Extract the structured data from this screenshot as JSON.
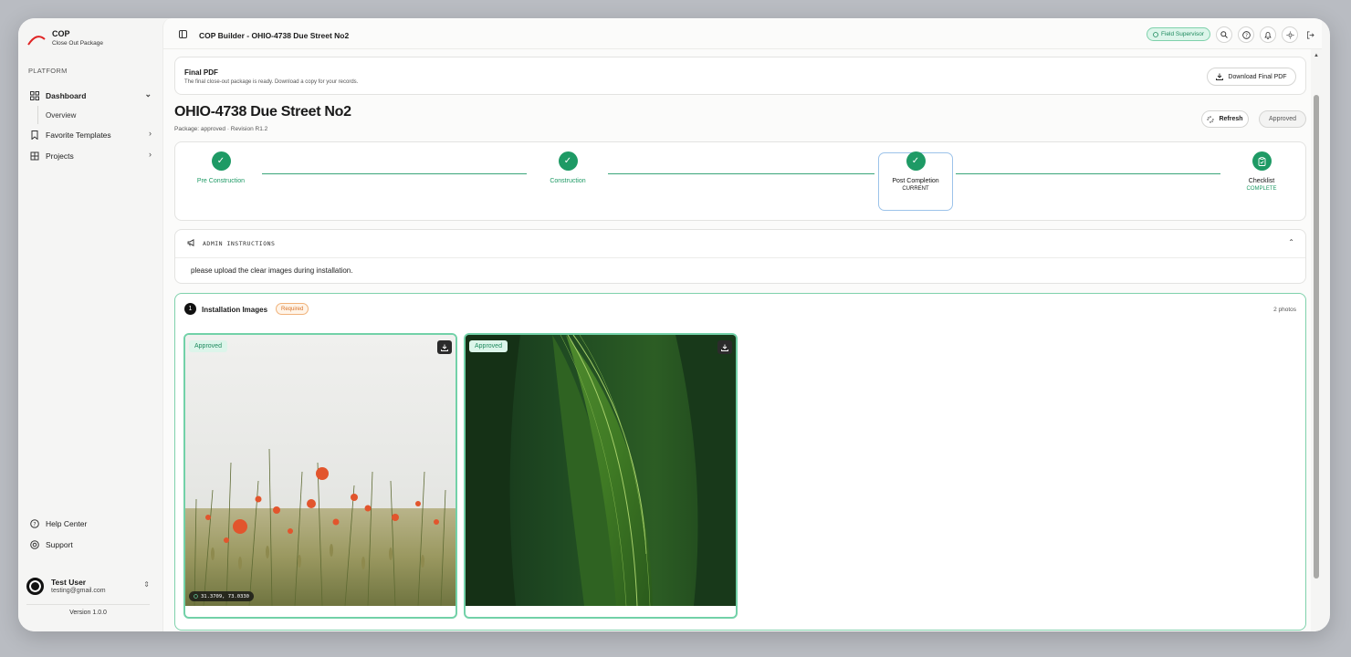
{
  "brand": {
    "title": "COP",
    "subtitle": "Close Out Package"
  },
  "sidebar": {
    "section_label": "PLATFORM",
    "items": [
      {
        "label": "Dashboard",
        "icon": "dashboard-icon"
      },
      {
        "label": "Overview"
      },
      {
        "label": "Favorite Templates",
        "icon": "bookmark-icon"
      },
      {
        "label": "Projects",
        "icon": "building-icon"
      }
    ],
    "bottom_items": [
      {
        "label": "Help Center",
        "icon": "help-icon"
      },
      {
        "label": "Support",
        "icon": "support-icon"
      }
    ],
    "user": {
      "name": "Test User",
      "email": "testing@gmail.com"
    },
    "version": "Version 1.0.0"
  },
  "topbar": {
    "title": "COP Builder - OHIO-4738 Due Street No2",
    "role": "Field Supervisor"
  },
  "final_pdf": {
    "title": "Final PDF",
    "subtitle": "The final close-out package is ready. Download a copy for your records.",
    "button": "Download Final PDF"
  },
  "package": {
    "title": "OHIO-4738 Due Street No2",
    "subtitle": "Package: approved · Revision R1.2",
    "refresh_label": "Refresh",
    "status": "Approved"
  },
  "steps": [
    {
      "label": "Pre Construction",
      "status": ""
    },
    {
      "label": "Construction",
      "status": ""
    },
    {
      "label": "Post Completion",
      "status": "CURRENT"
    },
    {
      "label": "Checklist",
      "status": "COMPLETE"
    }
  ],
  "admin": {
    "label": "ADMIN INSTRUCTIONS",
    "text": "please upload the clear images during installation."
  },
  "images_section": {
    "number": "1",
    "title": "Installation Images",
    "required_label": "Required",
    "count": "2 photos",
    "photos": [
      {
        "status": "Approved",
        "coords": "31.3709, 73.0330"
      },
      {
        "status": "Approved"
      }
    ]
  },
  "colors": {
    "accent": "#1e9a65",
    "approved_bg": "#dcf5ea",
    "required": "#d9742a"
  }
}
